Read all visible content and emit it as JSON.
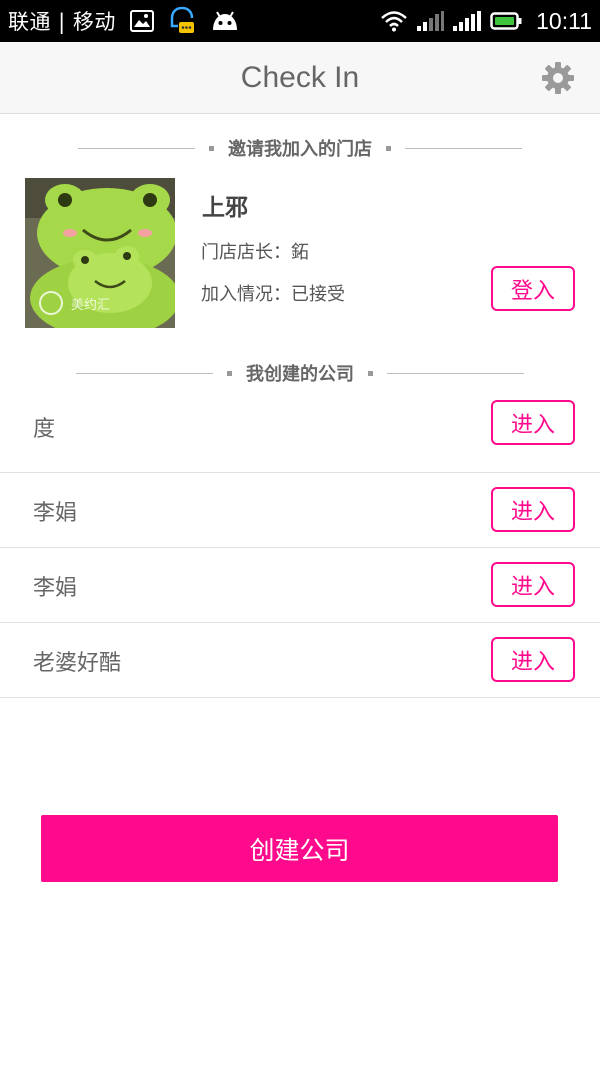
{
  "status_bar": {
    "carrier": "联通 | 移动",
    "time": "10:11"
  },
  "header": {
    "title": "Check In"
  },
  "invited_section": {
    "label": "邀请我加入的门店",
    "store": {
      "name": "上邪",
      "owner": "门店店长：鉐",
      "status": "加入情况：已接受",
      "login_label": "登入",
      "avatar_watermark": "美约汇"
    }
  },
  "created_section": {
    "label": "我创建的公司",
    "companies": [
      {
        "name": "度",
        "button": "进入"
      },
      {
        "name": "李娟",
        "button": "进入"
      },
      {
        "name": "李娟",
        "button": "进入"
      },
      {
        "name": "老婆好酷",
        "button": "进入"
      }
    ]
  },
  "create_button": {
    "label": "创建公司"
  },
  "colors": {
    "accent": "#ff0a8c"
  }
}
